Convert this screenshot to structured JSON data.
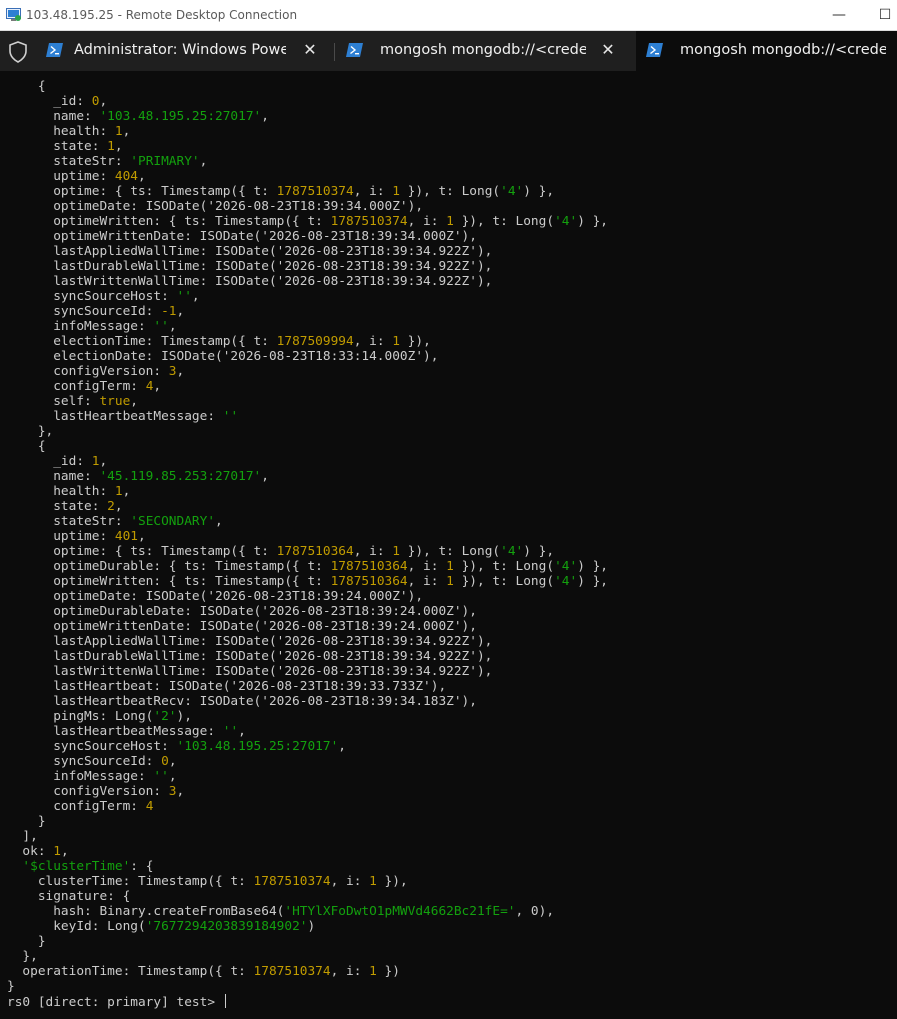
{
  "window": {
    "title": "103.48.195.25 - Remote Desktop Connection",
    "minimize_glyph": "—",
    "maximize_glyph": "☐"
  },
  "tabs": [
    {
      "label": "Administrator: Windows PowerShell",
      "icon": "powershell-icon",
      "active": false,
      "close_glyph": "✕"
    },
    {
      "label": "mongosh mongodb://<credentials>",
      "icon": "powershell-icon",
      "active": false,
      "close_glyph": "✕"
    },
    {
      "label": "mongosh mongodb://<credentials>",
      "icon": "powershell-icon",
      "active": true
    }
  ],
  "colors": {
    "terminal_bg": "#0c0c0c",
    "text": "#cccccc",
    "number": "#c19c00",
    "string": "#13a10e",
    "powershell_blue": "#2d7fd3"
  },
  "terminal_lines": [
    [
      [
        "k",
        "    {"
      ]
    ],
    [
      [
        "k",
        "      _id: "
      ],
      [
        "n",
        "0"
      ],
      [
        "k",
        ","
      ]
    ],
    [
      [
        "k",
        "      name: "
      ],
      [
        "s",
        "'103.48.195.25:27017'"
      ],
      [
        "k",
        ","
      ]
    ],
    [
      [
        "k",
        "      health: "
      ],
      [
        "n",
        "1"
      ],
      [
        "k",
        ","
      ]
    ],
    [
      [
        "k",
        "      state: "
      ],
      [
        "n",
        "1"
      ],
      [
        "k",
        ","
      ]
    ],
    [
      [
        "k",
        "      stateStr: "
      ],
      [
        "s",
        "'PRIMARY'"
      ],
      [
        "k",
        ","
      ]
    ],
    [
      [
        "k",
        "      uptime: "
      ],
      [
        "n",
        "404"
      ],
      [
        "k",
        ","
      ]
    ],
    [
      [
        "k",
        "      optime: { ts: Timestamp({ t: "
      ],
      [
        "n",
        "1787510374"
      ],
      [
        "k",
        ", i: "
      ],
      [
        "n",
        "1"
      ],
      [
        "k",
        " }), t: Long("
      ],
      [
        "s",
        "'4'"
      ],
      [
        "k",
        ") },"
      ]
    ],
    [
      [
        "k",
        "      optimeDate: ISODate('2026-08-23T18:39:34.000Z'),"
      ]
    ],
    [
      [
        "k",
        "      optimeWritten: { ts: Timestamp({ t: "
      ],
      [
        "n",
        "1787510374"
      ],
      [
        "k",
        ", i: "
      ],
      [
        "n",
        "1"
      ],
      [
        "k",
        " }), t: Long("
      ],
      [
        "s",
        "'4'"
      ],
      [
        "k",
        ") },"
      ]
    ],
    [
      [
        "k",
        "      optimeWrittenDate: ISODate('2026-08-23T18:39:34.000Z'),"
      ]
    ],
    [
      [
        "k",
        "      lastAppliedWallTime: ISODate('2026-08-23T18:39:34.922Z'),"
      ]
    ],
    [
      [
        "k",
        "      lastDurableWallTime: ISODate('2026-08-23T18:39:34.922Z'),"
      ]
    ],
    [
      [
        "k",
        "      lastWrittenWallTime: ISODate('2026-08-23T18:39:34.922Z'),"
      ]
    ],
    [
      [
        "k",
        "      syncSourceHost: "
      ],
      [
        "s",
        "''"
      ],
      [
        "k",
        ","
      ]
    ],
    [
      [
        "k",
        "      syncSourceId: "
      ],
      [
        "n",
        "-1"
      ],
      [
        "k",
        ","
      ]
    ],
    [
      [
        "k",
        "      infoMessage: "
      ],
      [
        "s",
        "''"
      ],
      [
        "k",
        ","
      ]
    ],
    [
      [
        "k",
        "      electionTime: Timestamp({ t: "
      ],
      [
        "n",
        "1787509994"
      ],
      [
        "k",
        ", i: "
      ],
      [
        "n",
        "1"
      ],
      [
        "k",
        " }),"
      ]
    ],
    [
      [
        "k",
        "      electionDate: ISODate('2026-08-23T18:33:14.000Z'),"
      ]
    ],
    [
      [
        "k",
        "      configVersion: "
      ],
      [
        "n",
        "3"
      ],
      [
        "k",
        ","
      ]
    ],
    [
      [
        "k",
        "      configTerm: "
      ],
      [
        "n",
        "4"
      ],
      [
        "k",
        ","
      ]
    ],
    [
      [
        "k",
        "      self: "
      ],
      [
        "n",
        "true"
      ],
      [
        "k",
        ","
      ]
    ],
    [
      [
        "k",
        "      lastHeartbeatMessage: "
      ],
      [
        "s",
        "''"
      ]
    ],
    [
      [
        "k",
        "    },"
      ]
    ],
    [
      [
        "k",
        "    {"
      ]
    ],
    [
      [
        "k",
        "      _id: "
      ],
      [
        "n",
        "1"
      ],
      [
        "k",
        ","
      ]
    ],
    [
      [
        "k",
        "      name: "
      ],
      [
        "s",
        "'45.119.85.253:27017'"
      ],
      [
        "k",
        ","
      ]
    ],
    [
      [
        "k",
        "      health: "
      ],
      [
        "n",
        "1"
      ],
      [
        "k",
        ","
      ]
    ],
    [
      [
        "k",
        "      state: "
      ],
      [
        "n",
        "2"
      ],
      [
        "k",
        ","
      ]
    ],
    [
      [
        "k",
        "      stateStr: "
      ],
      [
        "s",
        "'SECONDARY'"
      ],
      [
        "k",
        ","
      ]
    ],
    [
      [
        "k",
        "      uptime: "
      ],
      [
        "n",
        "401"
      ],
      [
        "k",
        ","
      ]
    ],
    [
      [
        "k",
        "      optime: { ts: Timestamp({ t: "
      ],
      [
        "n",
        "1787510364"
      ],
      [
        "k",
        ", i: "
      ],
      [
        "n",
        "1"
      ],
      [
        "k",
        " }), t: Long("
      ],
      [
        "s",
        "'4'"
      ],
      [
        "k",
        ") },"
      ]
    ],
    [
      [
        "k",
        "      optimeDurable: { ts: Timestamp({ t: "
      ],
      [
        "n",
        "1787510364"
      ],
      [
        "k",
        ", i: "
      ],
      [
        "n",
        "1"
      ],
      [
        "k",
        " }), t: Long("
      ],
      [
        "s",
        "'4'"
      ],
      [
        "k",
        ") },"
      ]
    ],
    [
      [
        "k",
        "      optimeWritten: { ts: Timestamp({ t: "
      ],
      [
        "n",
        "1787510364"
      ],
      [
        "k",
        ", i: "
      ],
      [
        "n",
        "1"
      ],
      [
        "k",
        " }), t: Long("
      ],
      [
        "s",
        "'4'"
      ],
      [
        "k",
        ") },"
      ]
    ],
    [
      [
        "k",
        "      optimeDate: ISODate('2026-08-23T18:39:24.000Z'),"
      ]
    ],
    [
      [
        "k",
        "      optimeDurableDate: ISODate('2026-08-23T18:39:24.000Z'),"
      ]
    ],
    [
      [
        "k",
        "      optimeWrittenDate: ISODate('2026-08-23T18:39:24.000Z'),"
      ]
    ],
    [
      [
        "k",
        "      lastAppliedWallTime: ISODate('2026-08-23T18:39:34.922Z'),"
      ]
    ],
    [
      [
        "k",
        "      lastDurableWallTime: ISODate('2026-08-23T18:39:34.922Z'),"
      ]
    ],
    [
      [
        "k",
        "      lastWrittenWallTime: ISODate('2026-08-23T18:39:34.922Z'),"
      ]
    ],
    [
      [
        "k",
        "      lastHeartbeat: ISODate('2026-08-23T18:39:33.733Z'),"
      ]
    ],
    [
      [
        "k",
        "      lastHeartbeatRecv: ISODate('2026-08-23T18:39:34.183Z'),"
      ]
    ],
    [
      [
        "k",
        "      pingMs: Long("
      ],
      [
        "s",
        "'2'"
      ],
      [
        "k",
        "),"
      ]
    ],
    [
      [
        "k",
        "      lastHeartbeatMessage: "
      ],
      [
        "s",
        "''"
      ],
      [
        "k",
        ","
      ]
    ],
    [
      [
        "k",
        "      syncSourceHost: "
      ],
      [
        "s",
        "'103.48.195.25:27017'"
      ],
      [
        "k",
        ","
      ]
    ],
    [
      [
        "k",
        "      syncSourceId: "
      ],
      [
        "n",
        "0"
      ],
      [
        "k",
        ","
      ]
    ],
    [
      [
        "k",
        "      infoMessage: "
      ],
      [
        "s",
        "''"
      ],
      [
        "k",
        ","
      ]
    ],
    [
      [
        "k",
        "      configVersion: "
      ],
      [
        "n",
        "3"
      ],
      [
        "k",
        ","
      ]
    ],
    [
      [
        "k",
        "      configTerm: "
      ],
      [
        "n",
        "4"
      ]
    ],
    [
      [
        "k",
        "    }"
      ]
    ],
    [
      [
        "k",
        "  ],"
      ]
    ],
    [
      [
        "k",
        "  ok: "
      ],
      [
        "n",
        "1"
      ],
      [
        "k",
        ","
      ]
    ],
    [
      [
        "k",
        "  "
      ],
      [
        "s",
        "'$clusterTime'"
      ],
      [
        "k",
        ": {"
      ]
    ],
    [
      [
        "k",
        "    clusterTime: Timestamp({ t: "
      ],
      [
        "n",
        "1787510374"
      ],
      [
        "k",
        ", i: "
      ],
      [
        "n",
        "1"
      ],
      [
        "k",
        " }),"
      ]
    ],
    [
      [
        "k",
        "    signature: {"
      ]
    ],
    [
      [
        "k",
        "      hash: Binary.createFromBase64("
      ],
      [
        "s",
        "'HTYlXFoDwtO1pMWVd4662Bc21fE='"
      ],
      [
        "k",
        ", 0),"
      ]
    ],
    [
      [
        "k",
        "      keyId: Long("
      ],
      [
        "s",
        "'7677294203839184902'"
      ],
      [
        "k",
        ")"
      ]
    ],
    [
      [
        "k",
        "    }"
      ]
    ],
    [
      [
        "k",
        "  },"
      ]
    ],
    [
      [
        "k",
        "  operationTime: Timestamp({ t: "
      ],
      [
        "n",
        "1787510374"
      ],
      [
        "k",
        ", i: "
      ],
      [
        "n",
        "1"
      ],
      [
        "k",
        " })"
      ]
    ],
    [
      [
        "k",
        "}"
      ]
    ]
  ],
  "prompt": "rs0 [direct: primary] test> "
}
